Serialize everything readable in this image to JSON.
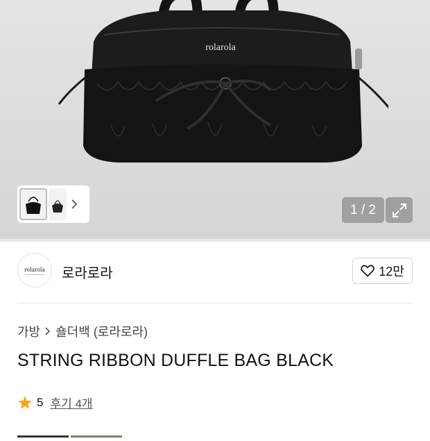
{
  "gallery": {
    "brand_print": "rolarola",
    "counter": "1 / 2",
    "icons": {
      "next": "chevron-right-icon",
      "expand": "expand-arrows-icon"
    }
  },
  "store": {
    "logo_text": "rolarola",
    "name": "로라로라",
    "like_count": "12만",
    "icons": {
      "like": "heart-outline-icon"
    }
  },
  "breadcrumb": {
    "category": "가방",
    "subcategory": "숄더백 (로라로라)",
    "separator_icon": "chevron-right-icon"
  },
  "product": {
    "title": "STRING RIBBON DUFFLE BAG BLACK",
    "rating": "5",
    "reviews": "후기 4개",
    "star_color": "#f5a623"
  },
  "colors": {
    "hero_bg": "#d9d9d9",
    "bag": "#1a1a1a"
  }
}
